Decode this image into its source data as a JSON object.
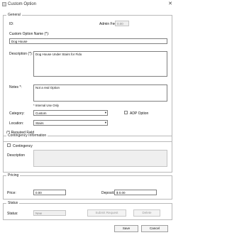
{
  "window": {
    "title": "Custom Option"
  },
  "general": {
    "legend": "General",
    "id_label": "ID:",
    "admin_fee_label": "Admin Fee:",
    "admin_fee_value": "0.00",
    "name_label": "Custom Option Name (*):",
    "name_value": "Dog House",
    "description_label": "Description (*):",
    "description_value": "Dog House Under Stairs for Fido",
    "notes_label": "Notes *:",
    "notes_value": "Not a real Option",
    "internal_note": "* Internal Use Only",
    "category_label": "Category:",
    "category_value": "Custom",
    "adp_label": "ADP Option",
    "location_label": "Location:",
    "location_value": "Stairs",
    "required_note": "(*) Required Field"
  },
  "contingency": {
    "legend": "Contingency Information",
    "checkbox_label": "Contingency",
    "description_label": "Description"
  },
  "pricing": {
    "legend": "Pricing",
    "price_label": "Price:",
    "price_value": "0.00",
    "deposit_label": "Deposit:",
    "deposit_value": "$ 0.00"
  },
  "status": {
    "legend": "Status",
    "status_label": "Status:",
    "status_value": "New",
    "submit_label": "Submit Request",
    "delete_label": "Delete"
  },
  "footer": {
    "save_label": "Save",
    "cancel_label": "Cancel"
  },
  "icons": {
    "dropdown_arrow": "chevron-down-icon",
    "close": "close-icon"
  }
}
